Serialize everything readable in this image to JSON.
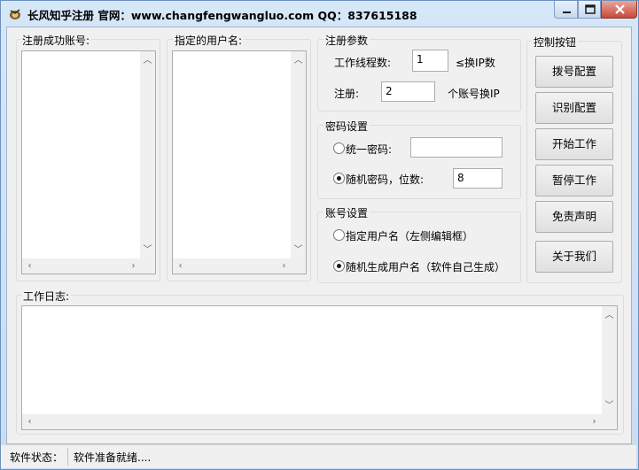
{
  "window": {
    "title": "长风知乎注册 官网：www.changfengwangluo.com QQ：837615188"
  },
  "left_panels": {
    "success_accounts_label": "注册成功账号:",
    "usernames_label": "指定的用户名:"
  },
  "register_params": {
    "group_title": "注册参数",
    "threads_label": "工作线程数:",
    "threads_value": "1",
    "threads_hint": "≤换IP数",
    "register_label": "注册:",
    "register_value": "2",
    "register_hint": "个账号换IP"
  },
  "password_settings": {
    "group_title": "密码设置",
    "unified_label": "统一密码:",
    "unified_value": "",
    "random_label": "随机密码，位数:",
    "random_digits": "8",
    "selected": "random"
  },
  "account_settings": {
    "group_title": "账号设置",
    "specified_label": "指定用户名（左侧编辑框）",
    "random_label": "随机生成用户名（软件自己生成）",
    "selected": "random"
  },
  "controls": {
    "group_title": "控制按钮",
    "buttons": [
      "拨号配置",
      "识别配置",
      "开始工作",
      "暂停工作",
      "免责声明",
      "关于我们"
    ]
  },
  "log": {
    "label": "工作日志:"
  },
  "status": {
    "label": "软件状态：",
    "value": "软件准备就绪...."
  }
}
